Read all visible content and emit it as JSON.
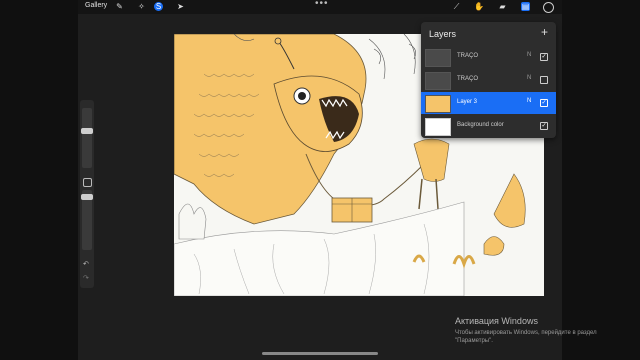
{
  "toolbar": {
    "gallery_label": "Gallery",
    "icons": [
      "wrench-icon",
      "wand-icon",
      "selection-icon",
      "transform-icon",
      "brush-icon",
      "smudge-icon",
      "eraser-icon",
      "layers-icon",
      "color-icon"
    ],
    "more": "•••"
  },
  "layers_panel": {
    "title": "Layers",
    "add": "+",
    "layers": [
      {
        "name": "TRAÇO",
        "mode": "N",
        "visible": true,
        "active": false
      },
      {
        "name": "TRAÇO",
        "mode": "N",
        "visible": false,
        "active": false
      },
      {
        "name": "Layer 3",
        "mode": "N",
        "visible": true,
        "active": true
      },
      {
        "name": "Background color",
        "mode": "",
        "visible": true,
        "active": false
      }
    ]
  },
  "colors": {
    "accent": "#1a6ef5",
    "fill": "#f5c46a",
    "paper": "#f7f7f3"
  },
  "watermark": {
    "title": "Активация Windows",
    "text": "Чтобы активировать Windows, перейдите в раздел \"Параметры\"."
  }
}
